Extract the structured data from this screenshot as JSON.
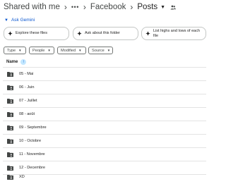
{
  "breadcrumb": {
    "root": "Shared with me",
    "more": "•••",
    "parent": "Facebook",
    "current": "Posts"
  },
  "gemini": {
    "toggle_label": "Ask Gemini",
    "suggestions": [
      {
        "label": "Explore these files"
      },
      {
        "label": "Ask about this folder"
      },
      {
        "label": "List highs and lows of each file"
      }
    ]
  },
  "filters": [
    {
      "label": "Type"
    },
    {
      "label": "People"
    },
    {
      "label": "Modified"
    },
    {
      "label": "Source"
    }
  ],
  "table": {
    "column_name": "Name",
    "sort": "ascending",
    "rows": [
      {
        "name": "05 - Mai"
      },
      {
        "name": "06 - Juin"
      },
      {
        "name": "07 - Juillet"
      },
      {
        "name": "08 - août"
      },
      {
        "name": "09 - Septembre"
      },
      {
        "name": "10 - Octobre"
      },
      {
        "name": "11 - Novembre"
      },
      {
        "name": "12 - Decembre"
      },
      {
        "name": "XD"
      }
    ]
  },
  "colors": {
    "accent": "#0b57d0",
    "text": "#1f1f1f",
    "muted": "#444746",
    "border": "#c4c7c5",
    "sort_bg": "#c2e7ff"
  },
  "icons": {
    "folder": "shared-folder-icon",
    "gemini": "sparkle-icon",
    "people": "people-icon"
  }
}
